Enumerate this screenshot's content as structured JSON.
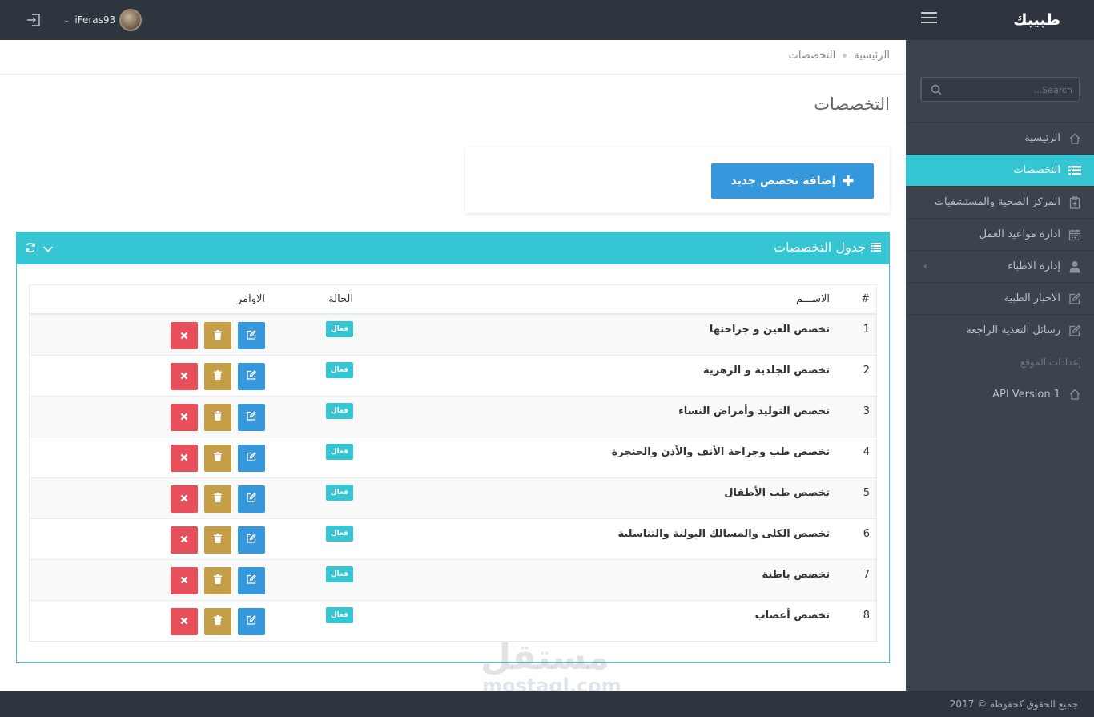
{
  "brand": "طبيبك",
  "user": {
    "name": "iFeras93"
  },
  "search": {
    "placeholder": "Search..."
  },
  "sidebar": {
    "items": [
      {
        "label": "الرئيسية"
      },
      {
        "label": "التخصصات"
      },
      {
        "label": "المركز الصحية والمستشفيات"
      },
      {
        "label": "ادارة مواعيد العمل"
      },
      {
        "label": "إدارة الاطباء"
      },
      {
        "label": "الاخبار الطبية"
      },
      {
        "label": "رسائل التغذية الراجعة"
      }
    ],
    "heading": "إعدادات الموقع",
    "api_label": "API Version 1"
  },
  "breadcrumb": {
    "home": "الرئيسية",
    "current": "التخصصات"
  },
  "page_title": "التخصصات",
  "add_button": "إضافة تخصص جديد",
  "portlet_title": "جدول التخصصات",
  "table": {
    "headers": {
      "num": "#",
      "name": "الاســـم",
      "status": "الحالة",
      "actions": "الاوامر"
    },
    "rows": [
      {
        "num": "1",
        "name": "تخصص العين و جراحتها",
        "status": "فعال"
      },
      {
        "num": "2",
        "name": "تخصص الجلدية و الزهرية",
        "status": "فعال"
      },
      {
        "num": "3",
        "name": "تخصص التوليد وأمراض النساء",
        "status": "فعال"
      },
      {
        "num": "4",
        "name": "تخصص طب وجراحة الأنف والأذن والحنجرة",
        "status": "فعال"
      },
      {
        "num": "5",
        "name": "تخصص طب الأطفال",
        "status": "فعال"
      },
      {
        "num": "6",
        "name": "تخصص الكلى والمسالك البولية والتناسلية",
        "status": "فعال"
      },
      {
        "num": "7",
        "name": "تخصص باطنة",
        "status": "فعال"
      },
      {
        "num": "8",
        "name": "تخصص أعصاب",
        "status": "فعال"
      }
    ]
  },
  "watermark": {
    "line1": "مستقل",
    "line2": "mostaql.com"
  },
  "footer": "2017 © جميع الحقوق كحفوظة",
  "colors": {
    "accent": "#36c6d3",
    "primary": "#3598dc",
    "warning": "#c49f47",
    "danger": "#e7505a",
    "dark": "#2f353f",
    "sidebar": "#3c434e"
  }
}
